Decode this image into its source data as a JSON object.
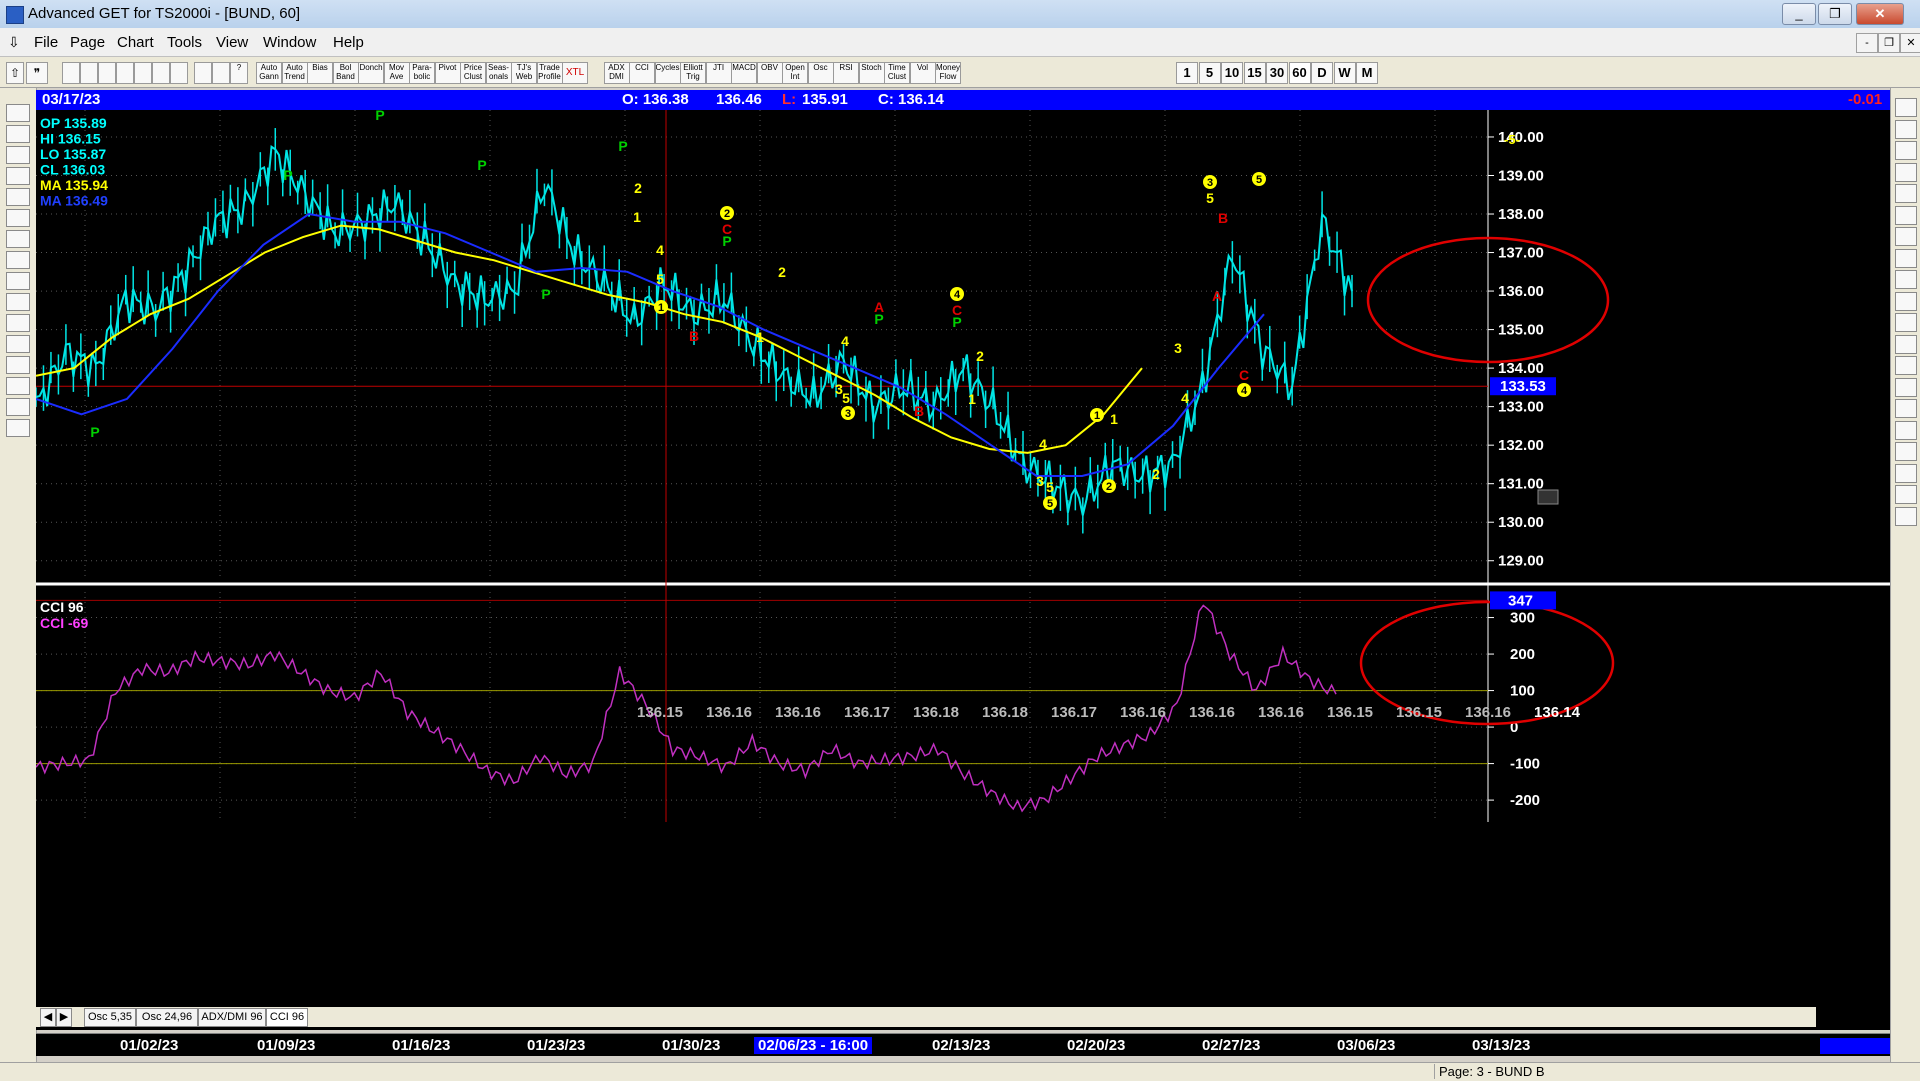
{
  "window": {
    "title": "Advanced GET for TS2000i - [BUND, 60]"
  },
  "menu": [
    "File",
    "Page",
    "Chart",
    "Tools",
    "View",
    "Window",
    "Help"
  ],
  "toolbar": {
    "studies": [
      "Auto Gann",
      "Auto Trend",
      "Bias",
      "Bol Band",
      "Donch",
      "Mov Ave",
      "Para-bolic",
      "Pivot",
      "Price Clust",
      "Seas-onals",
      "TJ's Web",
      "Trade Profile",
      "XTL",
      "ADX DMI",
      "CCI",
      "Cycles",
      "Elliott Trig",
      "JTI",
      "MACD",
      "OBV",
      "Open Int",
      "Osc",
      "RSI",
      "Stoch",
      "Time Clust",
      "Vol",
      "Money Flow"
    ],
    "intervals": [
      "1",
      "5",
      "10",
      "15",
      "30",
      "60",
      "D",
      "W",
      "M"
    ]
  },
  "infobar": {
    "date": "03/17/23",
    "open": "O: 136.38",
    "high": "136.46",
    "low_label": "L:",
    "low": "135.91",
    "close": "C: 136.14",
    "change": "-0.01"
  },
  "price_panel": {
    "readout": [
      {
        "label": "OP 135.89",
        "color": "#00ffff"
      },
      {
        "label": "HI  136.15",
        "color": "#00ffff"
      },
      {
        "label": "LO  135.87",
        "color": "#00ffff"
      },
      {
        "label": "CL  136.03",
        "color": "#00ffff"
      },
      {
        "label": "MA  135.94",
        "color": "#ffff00"
      },
      {
        "label": "MA  136.49",
        "color": "#2040ff"
      }
    ],
    "y_ticks": [
      "140.00",
      "139.00",
      "138.00",
      "137.00",
      "136.00",
      "135.00",
      "134.00",
      "133.00",
      "132.00",
      "131.00",
      "130.00",
      "129.00"
    ],
    "y_ticks_values": [
      140,
      139,
      138,
      137,
      136,
      135,
      134,
      133,
      132,
      131,
      130,
      129
    ],
    "ylim": [
      128.5,
      140.7
    ],
    "crosshair_price": "133.53",
    "last_price": "136.14",
    "bottom_values": [
      "136.15",
      "136.16",
      "136.16",
      "136.17",
      "136.18",
      "136.18",
      "136.17",
      "136.16",
      "136.16",
      "136.16",
      "136.15",
      "136.15",
      "136.16",
      "136.14"
    ],
    "top_marker": "-5-"
  },
  "cci_panel": {
    "label1": "CCI 96",
    "label2": "CCI  -69",
    "y_ticks": [
      "300",
      "200",
      "100",
      "0",
      "-100",
      "-200"
    ],
    "y_ticks_values": [
      300,
      200,
      100,
      0,
      -100,
      -200
    ],
    "current": "347",
    "ylim": [
      -260,
      370
    ]
  },
  "chart_data": {
    "type": "line",
    "x": [
      "01/02/23",
      "01/09/23",
      "01/16/23",
      "01/23/23",
      "01/30/23",
      "02/06/23",
      "02/13/23",
      "02/20/23",
      "02/27/23",
      "03/06/23",
      "03/13/23"
    ],
    "series": [
      {
        "values": [
          133.0,
          134.4,
          134.0,
          135.8,
          135.5,
          136.5,
          137.8,
          138.2,
          139.6,
          138.5,
          137.5,
          137.8,
          138.3,
          137.3,
          136.2,
          135.8,
          136.0,
          138.8,
          137.0,
          136.2,
          135.2,
          136.2,
          135.4,
          135.8,
          134.6,
          133.8,
          133.2,
          134.2,
          133.0,
          133.5,
          133.0,
          134.0,
          133.0,
          131.5,
          131.0,
          130.5,
          131.5,
          131.2,
          131.5,
          133.5,
          137.0,
          134.5,
          133.5,
          137.8,
          136.0
        ]
      },
      {
        "values": [
          133.8,
          134.0,
          134.8,
          135.4,
          135.8,
          136.4,
          137.0,
          137.4,
          137.7,
          137.6,
          137.3,
          137.0,
          136.8,
          136.5,
          136.2,
          135.9,
          135.7,
          135.4,
          135.2,
          134.8,
          134.3,
          133.8,
          133.3,
          132.7,
          132.2,
          131.9,
          131.8,
          132.0,
          132.8,
          134.0
        ]
      },
      {
        "values": [
          133.2,
          132.8,
          133.2,
          134.5,
          136.0,
          137.2,
          138.0,
          137.8,
          137.8,
          137.5,
          137.0,
          136.5,
          136.6,
          136.5,
          136.0,
          135.6,
          135.0,
          134.5,
          134.0,
          133.5,
          132.8,
          132.0,
          131.2,
          131.2,
          131.5,
          132.5,
          134.0,
          135.4
        ]
      },
      {
        "name": "CCI 96",
        "values": [
          -110,
          -100,
          -90,
          100,
          160,
          150,
          190,
          180,
          170,
          200,
          150,
          100,
          80,
          150,
          40,
          -10,
          -60,
          -120,
          -150,
          -80,
          -130,
          -100,
          150,
          60,
          -60,
          -80,
          -110,
          -40,
          -100,
          -120,
          -60,
          -100,
          -90,
          -80,
          -60,
          -130,
          -180,
          -220,
          -200,
          -140,
          -80,
          -50,
          -20,
          60,
          347,
          200,
          100,
          200,
          130,
          90
        ]
      }
    ],
    "annotations": [
      "P",
      "P",
      "P",
      "P",
      "P",
      "P",
      "P",
      "P",
      "P",
      "A",
      "A",
      "B",
      "B",
      "B",
      "C",
      "C",
      "C",
      "1",
      "2",
      "3",
      "4",
      "5"
    ]
  },
  "tabs": [
    "Osc 5,35",
    "Osc 24,96",
    "ADX/DMI 96",
    "CCI 96"
  ],
  "dates": [
    {
      "label": "01/02/23"
    },
    {
      "label": "01/09/23"
    },
    {
      "label": "01/16/23"
    },
    {
      "label": "01/23/23"
    },
    {
      "label": "01/30/23"
    },
    {
      "label": "02/06/23 - 16:00",
      "highlight": true
    },
    {
      "label": "02/13/23"
    },
    {
      "label": "02/20/23"
    },
    {
      "label": "02/27/23"
    },
    {
      "label": "03/06/23"
    },
    {
      "label": "03/13/23"
    }
  ],
  "status": "Page: 3 - BUND B",
  "colors": {
    "price": "#00e5e5",
    "ma_fast": "#ffff00",
    "ma_slow": "#1a2cff",
    "cci": "#c030c0",
    "circle": "#e00000",
    "pivot": "#00d000",
    "wave": "#ffff00",
    "abc": "#e00000"
  }
}
